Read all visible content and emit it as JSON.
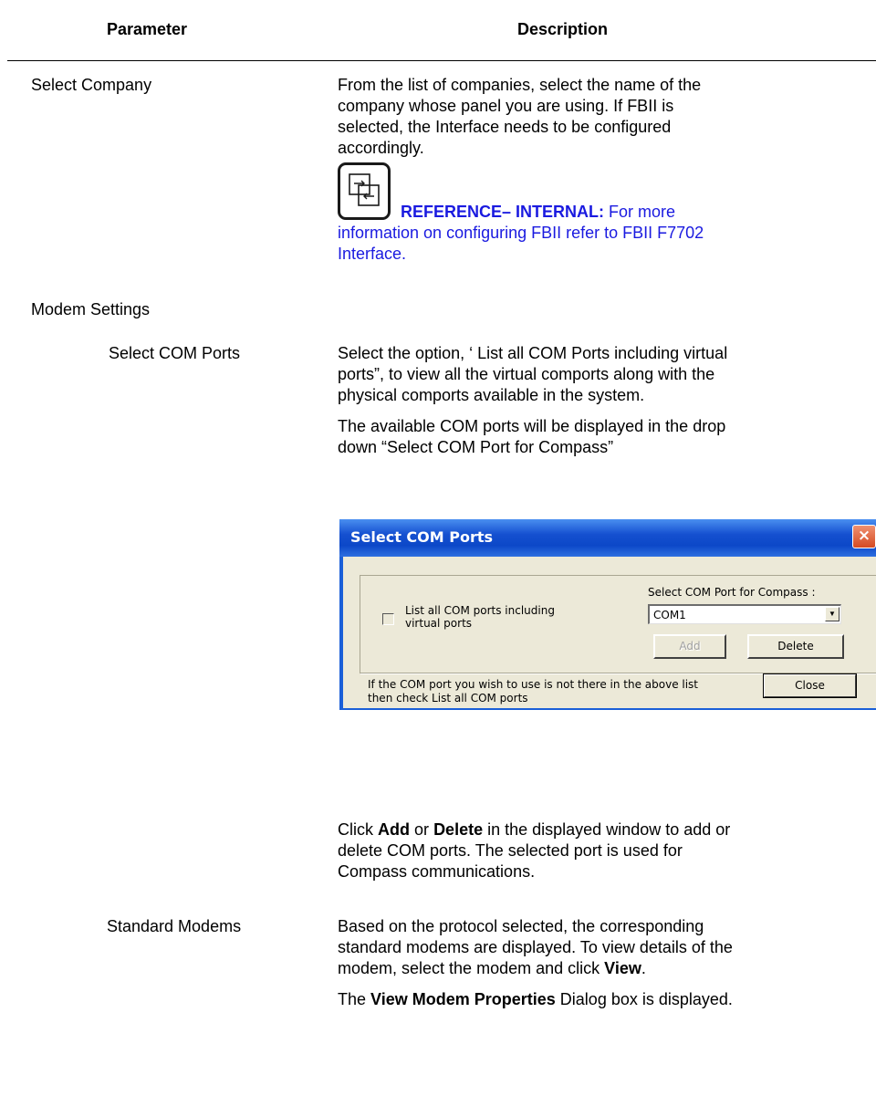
{
  "table": {
    "col_parameter": "Parameter",
    "col_description": "Description"
  },
  "rows": {
    "select_company": {
      "param": "Select Company",
      "desc_line1": "From the list of companies, select the name of the",
      "desc_line2": "company whose panel you are using. If FBII is",
      "desc_line3": "selected, the Interface needs to be configured",
      "desc_line4": "accordingly.",
      "reference_label": "REFERENCE– INTERNAL:",
      "reference_text1": "For more",
      "reference_text2": "information on configuring FBII refer to FBII F7702",
      "reference_text3": "Interface."
    },
    "modem_settings": {
      "param": "Modem Settings"
    },
    "select_com_ports": {
      "param": "Select COM Ports",
      "desc_p1_line1": "Select the option, ‘ List all COM Ports including virtual",
      "desc_p1_line2": "ports”, to view all the virtual comports along with the",
      "desc_p1_line3": "physical comports available in the system.",
      "desc_p2_line1": "The available COM ports will be displayed in the drop",
      "desc_p2_line2": "down “Select COM Port for Compass”",
      "desc_p3_click": "Click",
      "desc_p3_add": "Add",
      "desc_p3_or": "or",
      "desc_p3_delete": "Delete",
      "desc_p3_rest1": "in the displayed window to add or",
      "desc_p3_line2": "delete COM ports. The selected port is used for",
      "desc_p3_line3": "Compass communications."
    },
    "standard_modems": {
      "param": "Standard Modems",
      "desc_line1": "Based on the protocol selected, the corresponding",
      "desc_line2": "standard modems are displayed. To view details of the",
      "desc_line3_pre": "modem, select the modem and click",
      "desc_line3_view": "View",
      "desc_line3_post": ".",
      "desc_line4_the": "The",
      "desc_line4_bold": "View Modem Properties",
      "desc_line4_rest": "Dialog box is displayed."
    }
  },
  "dialog": {
    "title": "Select COM Ports",
    "close_glyph": "×",
    "checkbox_label_line1": "List all COM ports including",
    "checkbox_label_line2": "virtual ports",
    "select_label": "Select COM Port for Compass :",
    "select_value": "COM1",
    "add_label": "Add",
    "delete_label": "Delete",
    "hint_line1": "If the COM port you wish to use is not there in the above list",
    "hint_line2": "then check List all COM ports",
    "close_label": "Close"
  }
}
